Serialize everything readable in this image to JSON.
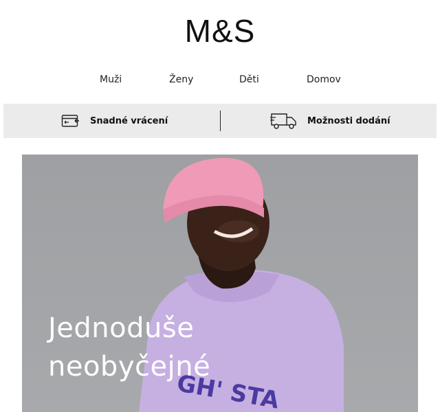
{
  "brand": {
    "logo_text": "M&S"
  },
  "nav": {
    "items": [
      {
        "label": "Muži"
      },
      {
        "label": "Ženy"
      },
      {
        "label": "Děti"
      },
      {
        "label": "Domov"
      }
    ]
  },
  "benefits": {
    "items": [
      {
        "label": "Snadné vrácení",
        "icon": "return-card-icon"
      },
      {
        "label": "Možnosti dodání",
        "icon": "delivery-truck-icon"
      }
    ]
  },
  "hero": {
    "title_line1": "Jednoduše",
    "title_line2": "neobyčejné",
    "image": "woman-pink-beanie-lilac-sweatshirt",
    "colors": {
      "background": "#a2a4a7",
      "beanie": "#ee9ab5",
      "sweatshirt": "#c8b2e3",
      "text": "#ffffff"
    }
  }
}
